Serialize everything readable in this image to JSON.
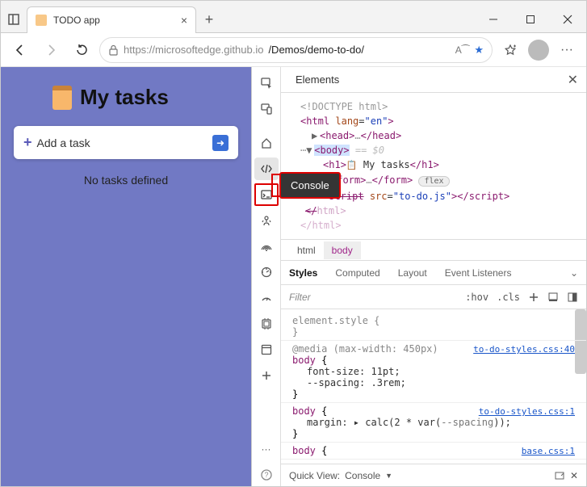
{
  "window": {
    "tab_title": "TODO app",
    "close": "×",
    "minimize": "–",
    "maximize": "☐"
  },
  "toolbar": {
    "url_host": "https://microsoftedge.github.io",
    "url_path": "/Demos/demo-to-do/",
    "reader": "A⁀"
  },
  "page": {
    "title": "My tasks",
    "add_placeholder": "Add a task",
    "empty": "No tasks defined"
  },
  "devtools": {
    "tooltip": "Console",
    "tabs": {
      "elements": "Elements"
    },
    "dom": {
      "doctype": "<!DOCTYPE html>",
      "html_open": "html",
      "html_lang_attr": "lang",
      "html_lang_val": "\"en\"",
      "head": "head",
      "head_close": "head",
      "body": "body",
      "body_anno": "== $0",
      "h1_open": "h1",
      "h1_text": " My tasks",
      "h1_close": "h1",
      "form": "form",
      "form_dots": "…",
      "form_close": "form",
      "form_pill": "flex",
      "script": "script",
      "script_src_attr": "src",
      "script_src_val": "\"to-do.js\"",
      "script_close": "script",
      "html_close": "html"
    },
    "crumbs": {
      "html": "html",
      "body": "body"
    },
    "styles_tabs": {
      "styles": "Styles",
      "computed": "Computed",
      "layout": "Layout",
      "listeners": "Event Listeners"
    },
    "filter": {
      "placeholder": "Filter",
      "hov": ":hov",
      "cls": ".cls"
    },
    "rules": {
      "r0_sel": "element.style",
      "media": "@media (max-width: 450px)",
      "r1_sel": "body",
      "r1_link": "to-do-styles.css:40",
      "r1_p1": "font-size: 11pt;",
      "r1_p2": "--spacing: .3rem;",
      "r2_sel": "body",
      "r2_link": "to-do-styles.css:1",
      "r2_p1_a": "margin",
      "r2_p1_b": "calc(2 * var(",
      "r2_p1_var": "--spacing",
      "r2_p1_c": "));",
      "r3_sel": "body",
      "r3_link": "base.css:1"
    },
    "quickview": {
      "label": "Quick View:",
      "console": "Console"
    }
  }
}
